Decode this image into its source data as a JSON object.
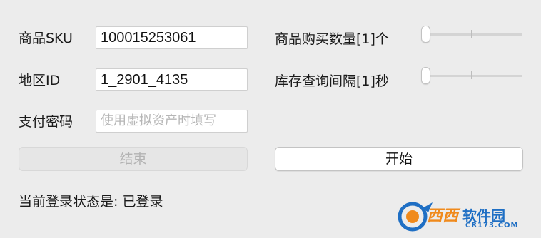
{
  "form": {
    "sku_label": "商品SKU",
    "sku_value": "100015253061",
    "region_label": "地区ID",
    "region_value": "1_2901_4135",
    "password_label": "支付密码",
    "password_placeholder": "使用虚拟资产时填写",
    "quantity_label": "商品购买数量[1]个",
    "quantity_value": 1,
    "interval_label": "库存查询间隔[1]秒",
    "interval_value": 1
  },
  "buttons": {
    "stop_label": "结束",
    "stop_enabled": false,
    "start_label": "开始",
    "start_enabled": true
  },
  "status": {
    "text": "当前登录状态是: 已登录"
  },
  "watermark": {
    "brand": "西西",
    "suffix": "软件园",
    "site": "CR173.COM"
  },
  "colors": {
    "window_bg": "#ececec",
    "watermark_blue": "#1f6fc4",
    "watermark_orange": "#f08a1c"
  }
}
